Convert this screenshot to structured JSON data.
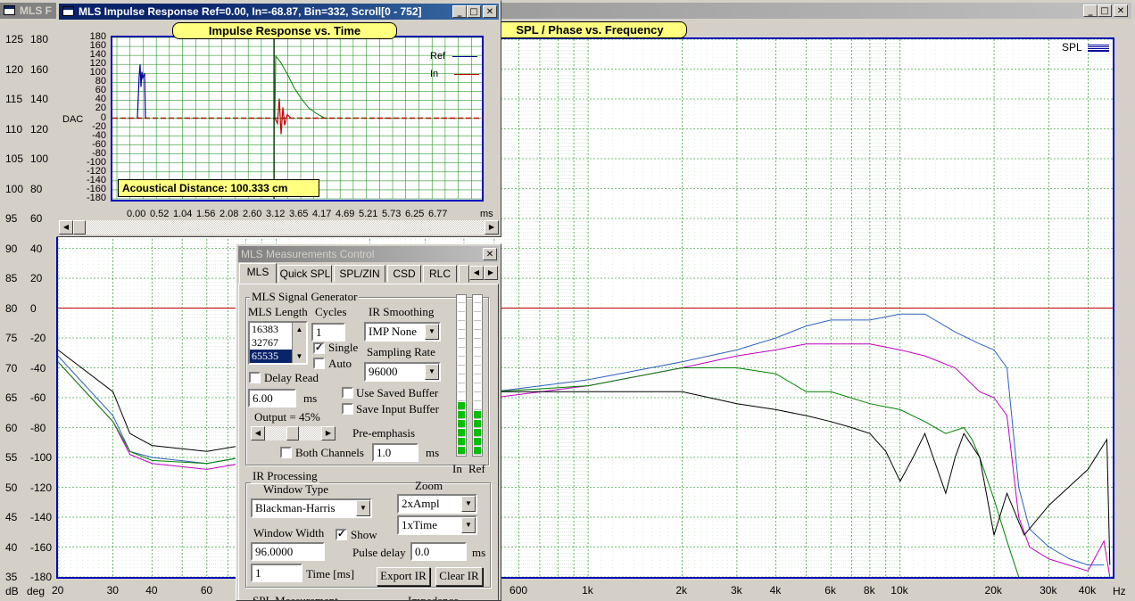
{
  "main_window": {
    "title": "MLS F",
    "chart_title": "SPL / Phase vs. Frequency",
    "legend": "SPL",
    "left_axis": {
      "db_ticks": [
        "125",
        "120",
        "115",
        "110",
        "105",
        "100",
        "95",
        "90",
        "85",
        "80",
        "75",
        "70",
        "65",
        "60",
        "55",
        "50",
        "45",
        "40",
        "35"
      ],
      "deg_ticks": [
        "180",
        "160",
        "140",
        "120",
        "100",
        "80",
        "60",
        "40",
        "20",
        "0",
        "-20",
        "-40",
        "-60",
        "-80",
        "-100",
        "-120",
        "-140",
        "-160",
        "-180"
      ],
      "db_unit": "dB",
      "deg_unit": "deg"
    },
    "x_ticks": [
      "20",
      "30",
      "40",
      "60",
      "600",
      "1k",
      "2k",
      "3k",
      "4k",
      "6k",
      "8k",
      "10k",
      "20k",
      "30k",
      "40k"
    ],
    "x_unit": "Hz"
  },
  "impulse_window": {
    "title": "MLS Impulse Response  Ref=0.00, In=-68.87, Bin=332, Scroll[0 - 752]",
    "chart_title": "Impulse Response vs. Time",
    "y_ticks": [
      "180",
      "160",
      "140",
      "120",
      "100",
      "80",
      "60",
      "40",
      "20",
      "0",
      "-20",
      "-40",
      "-60",
      "-80",
      "-100",
      "-120",
      "-140",
      "-160",
      "-180"
    ],
    "y_label": "DAC",
    "x_ticks": [
      "0.00",
      "0.52",
      "1.04",
      "1.56",
      "2.08",
      "2.60",
      "3.12",
      "3.65",
      "4.17",
      "4.69",
      "5.21",
      "5.73",
      "6.25",
      "6.77"
    ],
    "x_unit": "ms",
    "legend": [
      "Ref",
      "In"
    ],
    "distance": "Acoustical Distance: 100.333 cm"
  },
  "control_window": {
    "title": "MLS Measurements Control",
    "tabs": [
      "MLS",
      "Quick SPL",
      "SPL/ZIN",
      "CSD",
      "RLC"
    ],
    "generator": {
      "group": "MLS Signal Generator",
      "mls_length_label": "MLS Length",
      "mls_options": [
        "16383",
        "32767",
        "65535"
      ],
      "cycles_label": "Cycles",
      "cycles_value": "1",
      "single_label": "Single",
      "auto_label": "Auto",
      "ir_smoothing_label": "IR Smoothing",
      "ir_smoothing_value": "IMP None",
      "sampling_rate_label": "Sampling Rate",
      "sampling_rate_value": "96000",
      "delay_read_label": "Delay Read",
      "delay_value": "6.00",
      "delay_unit": "ms",
      "use_saved_label": "Use Saved Buffer",
      "save_input_label": "Save Input Buffer",
      "output_label": "Output = 45%",
      "preemphasis_label": "Pre-emphasis",
      "both_channels_label": "Both Channels",
      "preemph_value": "1.0",
      "preemph_unit": "ms",
      "meter_in": "In",
      "meter_ref": "Ref"
    },
    "ir": {
      "group": "IR Processing",
      "window_type_label": "Window Type",
      "window_type_value": "Blackman-Harris",
      "zoom_label": "Zoom",
      "zoom_ampl": "2xAmpl",
      "zoom_time": "1xTime",
      "window_width_label": "Window Width",
      "window_width_value": "96.0000",
      "show_label": "Show",
      "pulse_delay_label": "Pulse delay",
      "pulse_delay_value": "0.0",
      "pulse_delay_unit": "ms",
      "time_value": "1",
      "time_label": "Time [ms]",
      "export_label": "Export IR",
      "clear_label": "Clear IR"
    },
    "bottom_groups": [
      "SPL Measurement",
      "Impedance"
    ]
  }
}
